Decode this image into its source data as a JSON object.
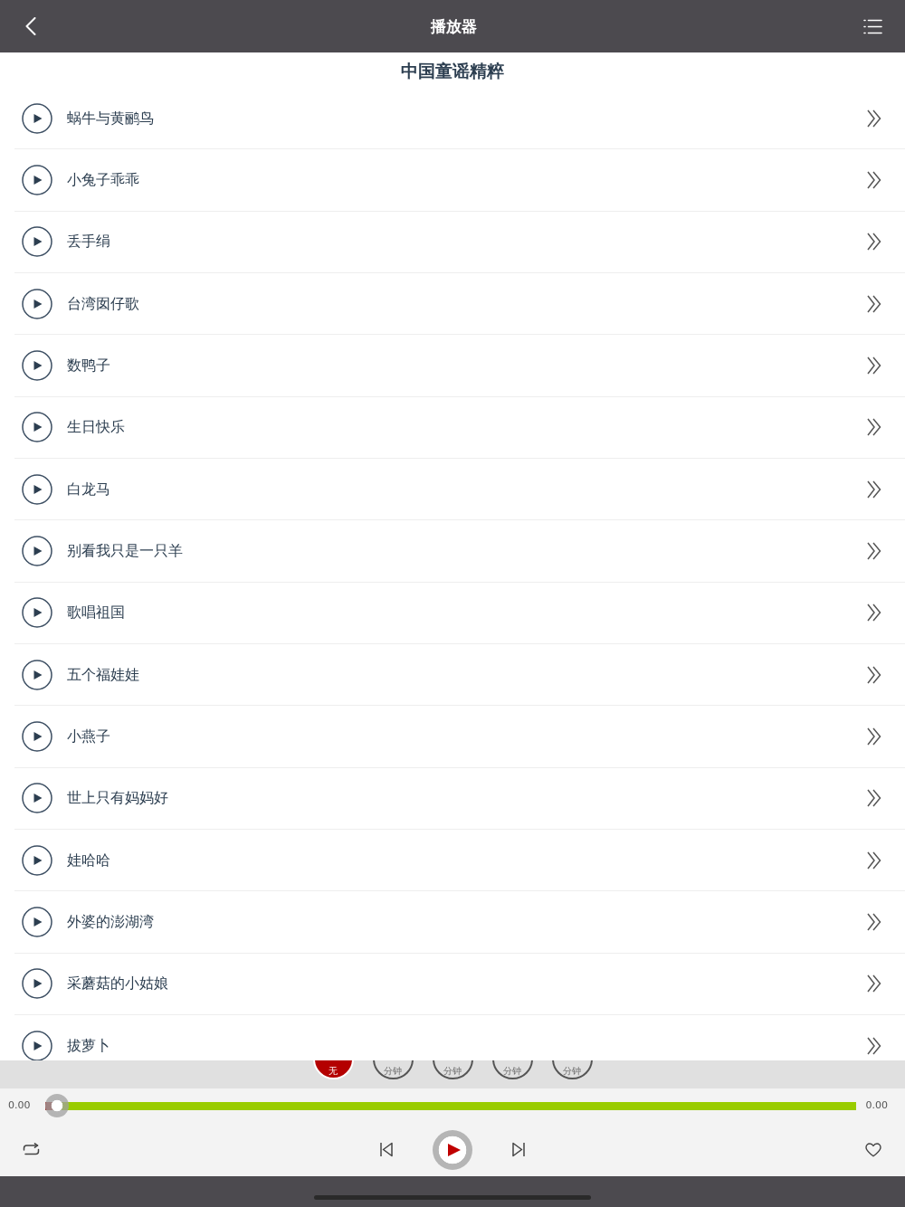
{
  "header": {
    "title": "播放器"
  },
  "album": {
    "title": "中国童谣精粹"
  },
  "songs": [
    {
      "title": "蜗牛与黄鹂鸟"
    },
    {
      "title": "小兔子乖乖"
    },
    {
      "title": "丢手绢"
    },
    {
      "title": "台湾囡仔歌"
    },
    {
      "title": "数鸭子"
    },
    {
      "title": "生日快乐"
    },
    {
      "title": "白龙马"
    },
    {
      "title": "别看我只是一只羊"
    },
    {
      "title": "歌唱祖国"
    },
    {
      "title": "五个福娃娃"
    },
    {
      "title": "小燕子"
    },
    {
      "title": "世上只有妈妈好"
    },
    {
      "title": "娃哈哈"
    },
    {
      "title": "外婆的澎湖湾"
    },
    {
      "title": "采蘑菇的小姑娘"
    },
    {
      "title": "拔萝卜"
    }
  ],
  "timer": {
    "options": [
      {
        "label": "无",
        "selected": true
      },
      {
        "label": "分钟",
        "selected": false
      },
      {
        "label": "分钟",
        "selected": false
      },
      {
        "label": "分钟",
        "selected": false
      },
      {
        "label": "分钟",
        "selected": false
      }
    ]
  },
  "progress": {
    "elapsed": "0.00",
    "total": "0.00",
    "level": 0
  },
  "controls": {
    "playing": false,
    "liked": false
  }
}
